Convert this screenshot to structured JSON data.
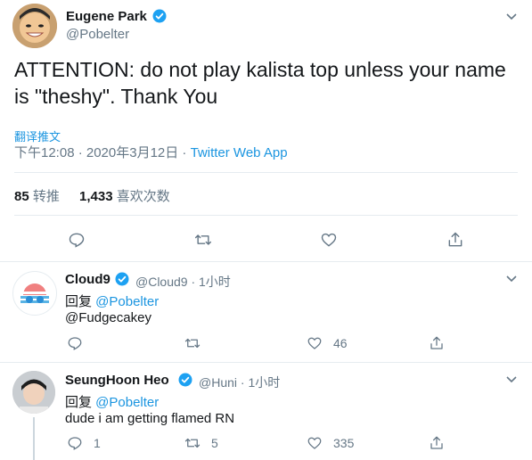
{
  "main_tweet": {
    "display_name": "Eugene Park",
    "handle": "@Pobelter",
    "text": "ATTENTION: do not play kalista top unless your name is \"theshy\". Thank You",
    "translate_label": "翻译推文",
    "timestamp": "下午12:08 · 2020年3月12日 · ",
    "source": "Twitter Web App",
    "retweet_count": "85",
    "retweet_label": "转推",
    "like_count": "1,433",
    "like_label": "喜欢次数"
  },
  "replies": [
    {
      "display_name": "Cloud9",
      "handle": "@Cloud9",
      "time": " · 1小时",
      "reply_prefix": "回复 ",
      "reply_to": "@Pobelter",
      "body_mention": "@Fudgecakey",
      "body": "",
      "reply_count": "",
      "retweet_count": "",
      "like_count": "46"
    },
    {
      "display_name": "SeungHoon Heo",
      "handle": "@Huni",
      "time": " · 1小时",
      "reply_prefix": "回复 ",
      "reply_to": "@Pobelter",
      "body_mention": "",
      "body": "dude i am getting flamed RN",
      "reply_count": "1",
      "retweet_count": "5",
      "like_count": "335"
    }
  ],
  "colors": {
    "accent": "#1b95e0",
    "muted": "#657786",
    "verified": "#1da1f2"
  },
  "icons": [
    "verified-icon",
    "chevron-down-icon",
    "reply-icon",
    "retweet-icon",
    "like-icon",
    "share-icon"
  ]
}
